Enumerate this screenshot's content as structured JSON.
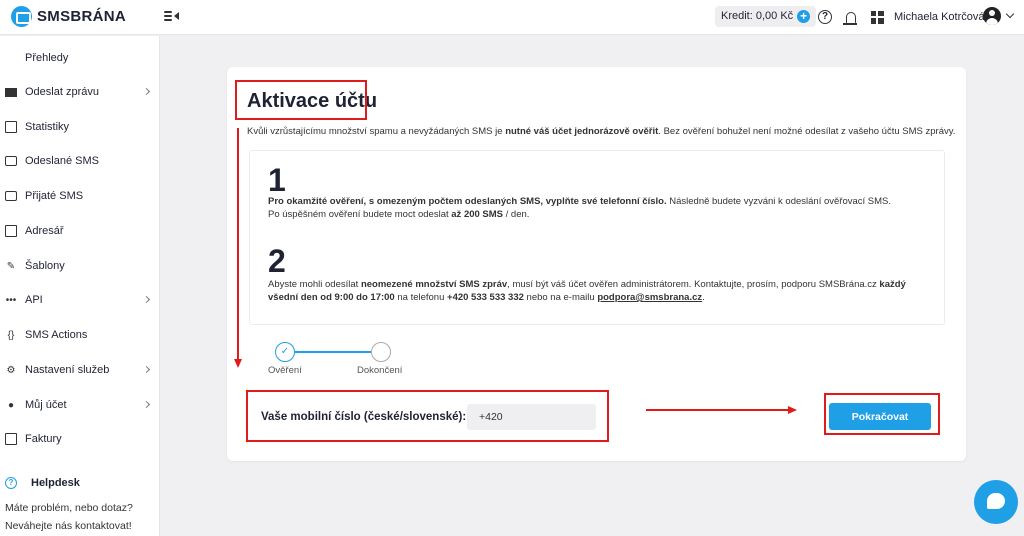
{
  "brand": {
    "name": "SMSBRÁNA",
    "accent": "#1f9fe6",
    "annotation_color": "#e01b1b"
  },
  "header": {
    "credit_label": "Kredit:",
    "credit_value": "0,00 Kč",
    "credit_add": "+",
    "help": "?",
    "user_name": "Michaela Kotrčová"
  },
  "sidebar": {
    "items": [
      {
        "label": "Přehledy",
        "icon": "dashboard-icon",
        "expandable": false
      },
      {
        "label": "Odeslat zprávu",
        "icon": "mail-icon",
        "expandable": true
      },
      {
        "label": "Statistiky",
        "icon": "chart-icon",
        "expandable": false
      },
      {
        "label": "Odeslané SMS",
        "icon": "sent-sms-icon",
        "expandable": false
      },
      {
        "label": "Přijaté SMS",
        "icon": "received-sms-icon",
        "expandable": false
      },
      {
        "label": "Adresář",
        "icon": "address-book-icon",
        "expandable": false
      },
      {
        "label": "Šablony",
        "icon": "template-icon",
        "expandable": false
      },
      {
        "label": "API",
        "icon": "api-icon",
        "expandable": true
      },
      {
        "label": "SMS Actions",
        "icon": "code-braces-icon",
        "expandable": false
      },
      {
        "label": "Nastavení služeb",
        "icon": "settings-icon",
        "expandable": true
      },
      {
        "label": "Můj účet",
        "icon": "user-icon",
        "expandable": true
      },
      {
        "label": "Faktury",
        "icon": "invoice-icon",
        "expandable": false
      }
    ],
    "helpdesk": {
      "title": "Helpdesk",
      "line1": "Máte problém, nebo dotaz?",
      "line2": "Neváhejte nás kontaktovat!"
    }
  },
  "main": {
    "title": "Aktivace účtu",
    "intro": {
      "part1": "Kvůli vzrůstajícímu množství spamu a nevyžádaných SMS je ",
      "bold": "nutné váš účet jednorázově ověřit",
      "part2": ". Bez ověření bohužel není možné odesílat z vašeho účtu SMS zprávy."
    },
    "step1": {
      "number": "1",
      "bold": "Pro okamžité ověření, s omezeným počtem odeslaných SMS, vyplňte své telefonní číslo.",
      "rest": " Následně budete vyzváni k odeslání ověřovací SMS.",
      "line2_pre": "Po úspěšném ověření budete moct odeslat ",
      "line2_bold": "až 200 SMS",
      "line2_post": " / den."
    },
    "step2": {
      "number": "2",
      "pre": "Abyste mohli odesílat ",
      "bold1": "neomezené množství SMS zpráv",
      "mid": ", musí být váš účet ověřen administrátorem. Kontaktujte, prosím, podporu SMSBrána.cz ",
      "bold2": "každý",
      "line2_bold": "všední den od 9:00 do 17:00",
      "line2_mid": " na telefonu ",
      "phone": "+420 533 533 332",
      "line2_mid2": " nebo na e-mailu ",
      "email": "podpora@smsbrana.cz",
      "line2_end": "."
    },
    "stepper": {
      "steps": [
        "Ověření",
        "Dokončení"
      ],
      "check": "✓"
    },
    "phone_form": {
      "label": "Vaše mobilní číslo (české/slovenské):",
      "value": "+420",
      "submit": "Pokračovat"
    }
  }
}
